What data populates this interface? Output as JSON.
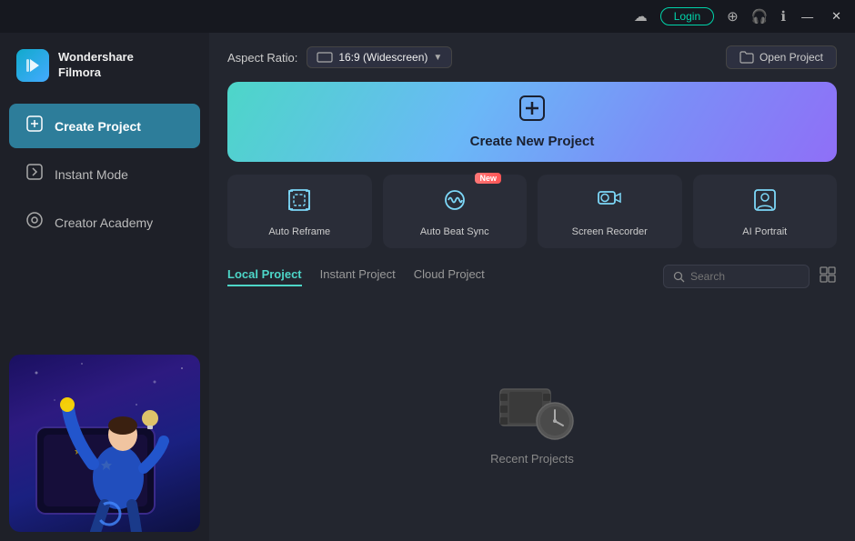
{
  "titlebar": {
    "login_label": "Login",
    "minimize": "—",
    "close": "✕"
  },
  "logo": {
    "name": "Wondershare\nFilmora",
    "line1": "Wondershare",
    "line2": "Filmora"
  },
  "sidebar": {
    "items": [
      {
        "id": "create-project",
        "label": "Create Project",
        "active": true
      },
      {
        "id": "instant-mode",
        "label": "Instant Mode",
        "active": false
      },
      {
        "id": "creator-academy",
        "label": "Creator Academy",
        "active": false
      }
    ]
  },
  "topbar": {
    "aspect_ratio_label": "Aspect Ratio:",
    "aspect_value": "16:9 (Widescreen)",
    "open_project_label": "Open Project"
  },
  "banner": {
    "label": "Create New Project"
  },
  "feature_cards": [
    {
      "id": "auto-reframe",
      "label": "Auto Reframe",
      "new": false
    },
    {
      "id": "auto-beat-sync",
      "label": "Auto Beat Sync",
      "new": true
    },
    {
      "id": "screen-recorder",
      "label": "Screen Recorder",
      "new": false
    },
    {
      "id": "ai-portrait",
      "label": "AI Portrait",
      "new": false
    }
  ],
  "project_tabs": [
    {
      "id": "local",
      "label": "Local Project",
      "active": true
    },
    {
      "id": "instant",
      "label": "Instant Project",
      "active": false
    },
    {
      "id": "cloud",
      "label": "Cloud Project",
      "active": false
    }
  ],
  "search": {
    "placeholder": "Search"
  },
  "empty_state": {
    "label": "Recent Projects"
  },
  "new_badge_label": "New"
}
